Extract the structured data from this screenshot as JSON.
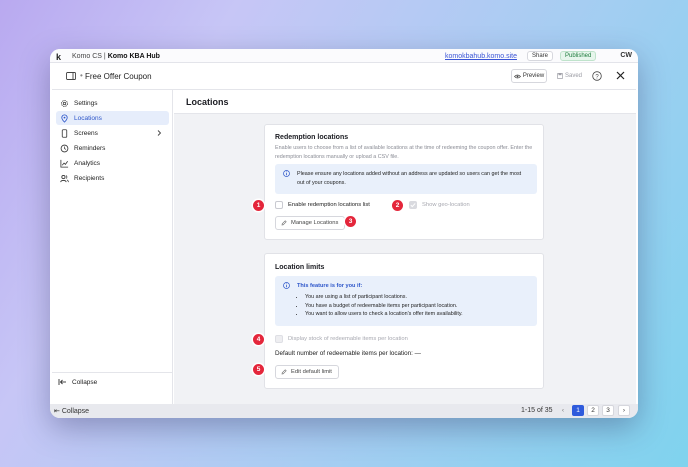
{
  "background_app": {
    "logo": "k",
    "breadcrumb_prefix": "Komo CS",
    "breadcrumb_separator": "|",
    "hub_name": "Komo KBA Hub",
    "hub_link": "komokbahub.komo.site",
    "share_label": "Share",
    "published_label": "Published",
    "avatar_initials": "CW",
    "collapse_label": "Collapse",
    "pagination": {
      "range": "1-15 of 35",
      "prev": "‹",
      "pages": [
        "1",
        "2",
        "3"
      ],
      "next": "›",
      "current": "1"
    }
  },
  "modal": {
    "title": "Free Offer Coupon",
    "preview_label": "Preview",
    "saved_label": "Saved"
  },
  "sidebar": {
    "items": [
      {
        "label": "Settings",
        "icon": "gear-icon"
      },
      {
        "label": "Locations",
        "icon": "location-pin-icon",
        "active": true
      },
      {
        "label": "Screens",
        "icon": "phone-icon",
        "has_submenu": true
      },
      {
        "label": "Reminders",
        "icon": "clock-icon"
      },
      {
        "label": "Analytics",
        "icon": "chart-icon"
      },
      {
        "label": "Recipients",
        "icon": "users-icon"
      }
    ],
    "collapse_label": "Collapse"
  },
  "main": {
    "page_title": "Locations",
    "redemption": {
      "title": "Redemption locations",
      "description": "Enable users to choose from a list of available locations at the time of redeeming the coupon offer. Enter the redemption locations manually or upload a CSV file.",
      "info": "Please ensure any locations added without an address are updated so users can get the most out of your coupons.",
      "enable_list_label": "Enable redemption locations list",
      "geo_label": "Show geo-location",
      "manage_button": "Manage Locations"
    },
    "limits": {
      "title": "Location limits",
      "info_heading": "This feature is for you if:",
      "info_items": [
        "You are using a list of participant locations.",
        "You have a budget of redeemable items per participant location.",
        "You want to allow users to check a location's offer item availability."
      ],
      "display_stock_label": "Display stock of redeemable items per location",
      "default_text": "Default number of redeemable items per location: —",
      "edit_button": "Edit default limit"
    }
  },
  "annotations": [
    "1",
    "2",
    "3",
    "4",
    "5"
  ],
  "colors": {
    "accent": "#2c55c9",
    "badge": "#e4263b",
    "active_nav_bg": "#e6edfb",
    "info_bg": "#e9f0fb",
    "pagination_active": "#2f5bdc"
  }
}
